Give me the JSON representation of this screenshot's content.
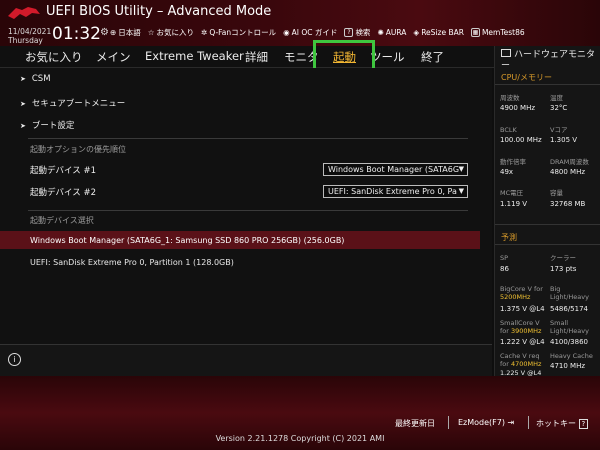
{
  "header": {
    "title": "UEFI BIOS Utility – Advanced Mode",
    "date": "11/04/2021",
    "day": "Thursday",
    "time": "01:32",
    "toolbar": [
      {
        "icon": "globe-icon",
        "label": "日本語"
      },
      {
        "icon": "star-icon",
        "label": "お気に入り"
      },
      {
        "icon": "fan-icon",
        "label": "Q-Fanコントロール"
      },
      {
        "icon": "ai-oc-icon",
        "label": "AI OC ガイド"
      },
      {
        "icon": "help-icon",
        "label": "検索"
      },
      {
        "icon": "aura-icon",
        "label": "AURA"
      },
      {
        "icon": "resize-bar-icon",
        "label": "ReSize BAR"
      },
      {
        "icon": "memtest-icon",
        "label": "MemTest86"
      }
    ]
  },
  "menu": {
    "favorites": "お気に入り",
    "main": "メイン",
    "extreme": "Extreme Tweaker",
    "advanced": "詳細",
    "monitor": "モニタ",
    "boot": "起動",
    "tool": "ツール",
    "exit": "終了"
  },
  "boot": {
    "csm": "CSM",
    "secure_boot": "セキュアブートメニュー",
    "boot_config": "ブート設定",
    "priority_label": "起動オプションの優先順位",
    "dev1_label": "起動デバイス #1",
    "dev1_value": "Windows Boot Manager (SATA6G",
    "dev2_label": "起動デバイス #2",
    "dev2_value": "UEFI: SanDisk Extreme Pro 0, Pa",
    "override_label": "起動デバイス選択",
    "override1": "Windows Boot Manager (SATA6G_1: Samsung SSD 860 PRO 256GB) (256.0GB)",
    "override2": "UEFI: SanDisk Extreme Pro 0, Partition 1 (128.0GB)"
  },
  "hw": {
    "title": "ハードウェアモニター",
    "cpu_section": "CPU/メモリー",
    "freq_label": "周波数",
    "freq_value": "4900 MHz",
    "temp_label": "温度",
    "temp_value": "32°C",
    "bclk_label": "BCLK",
    "bclk_value": "100.00 MHz",
    "vcore_label": "Vコア",
    "vcore_value": "1.305 V",
    "ratio_label": "動作倍率",
    "ratio_value": "49x",
    "dram_label": "DRAM周波数",
    "dram_value": "4800 MHz",
    "mc_label": "MC電圧",
    "mc_value": "1.119 V",
    "cap_label": "容量",
    "cap_value": "32768 MB",
    "pred_section": "予測",
    "sp_label": "SP",
    "sp_value": "86",
    "cooler_label": "クーラー",
    "cooler_value": "173 pts",
    "big_label": "BigCore V for",
    "big_freq": "5200MHz",
    "big_value": "1.375 V @L4",
    "big_r_label1": "Big",
    "big_r_label2": "Light/Heavy",
    "big_r_value": "5486/5174",
    "small_label": "SmallCore V",
    "small_label2": "for",
    "small_freq": "3900MHz",
    "small_value": "1.222 V @L4",
    "small_r_label1": "Small",
    "small_r_label2": "Light/Heavy",
    "small_r_value": "4100/3860",
    "cache_label": "Cache V req",
    "cache_label2": "for",
    "cache_freq": "4700MHz",
    "cache_value": "1.225 V @L4",
    "cache_r_label": "Heavy Cache",
    "cache_r_value": "4710 MHz"
  },
  "footer": {
    "last": "最終更新日",
    "ez": "EzMode(F7)",
    "hotkey": "ホットキー",
    "version": "Version 2.21.1278 Copyright (C) 2021 AMI"
  }
}
